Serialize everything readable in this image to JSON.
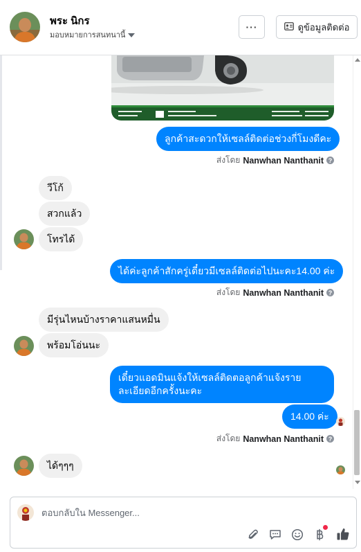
{
  "header": {
    "name": "พระ นิกร",
    "subtitle": "มอบหมายการสนทนานี้",
    "more_label": "···",
    "contact_label": "ดูข้อมูลติดต่อ"
  },
  "messages": {
    "out1": "ลูกค้าสะดวกให้เซลล์ติดต่อช่วงกี่โมงดีคะ",
    "in1": "วีโก้",
    "in2": "สวกแล้ว",
    "in3": "โทรได้",
    "out2": "ได้ค่ะลูกค้าสักครู่เดี๋ยวมีเซลล์ติดต่อไปนะคะ14.00 ค่ะ",
    "in4": "มีรุ่นไหนบ้างราคาแสนหมื่น",
    "in5": "พร้อมโอ่นนะ",
    "out3_line1": "เดี๋ยวแอดมินแจ้งให้เซลล์ติดตอลูกค้าแจ้งราย",
    "out3_line2": "ละเอียดอีกครั้งนะคะ",
    "out4": "14.00 ค่ะ",
    "in6": "ได้ๆๆๆ"
  },
  "sent_by": {
    "prefix": "ส่งโดย",
    "name": "Nanwhan Nanthanit",
    "help": "?"
  },
  "composer": {
    "placeholder": "ตอบกลับใน Messenger..."
  },
  "icons": [
    "paperclip-icon",
    "speech-bubble-icon",
    "emoji-icon",
    "baht-icon",
    "thumbs-up-icon"
  ],
  "colors": {
    "outgoing_bubble": "#0084ff",
    "incoming_bubble": "#f0f0f0",
    "notification_dot": "#f02849"
  }
}
